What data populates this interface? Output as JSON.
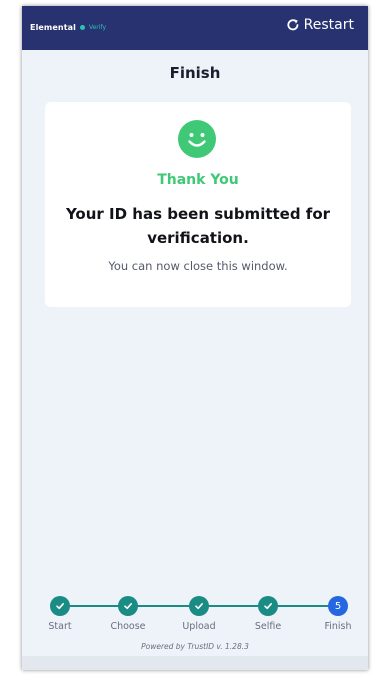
{
  "header": {
    "brand_name": "Elemental",
    "brand_sub": "Verify",
    "restart_label": "Restart",
    "bar_color": "#283270"
  },
  "page": {
    "title": "Finish"
  },
  "card": {
    "icon": "smiley-icon",
    "thanks": "Thank You",
    "headline": "Your ID has been submitted for verification.",
    "subtext": "You can now close this window."
  },
  "stepper": {
    "steps": [
      {
        "label": "Start",
        "state": "done"
      },
      {
        "label": "Choose",
        "state": "done"
      },
      {
        "label": "Upload",
        "state": "done"
      },
      {
        "label": "Selfie",
        "state": "done"
      },
      {
        "label": "Finish",
        "state": "current",
        "number": "5"
      }
    ],
    "done_color": "#1a8c84",
    "current_color": "#2567e0"
  },
  "footer": {
    "powered_by": "Powered by TrustID v. 1.28.3"
  }
}
